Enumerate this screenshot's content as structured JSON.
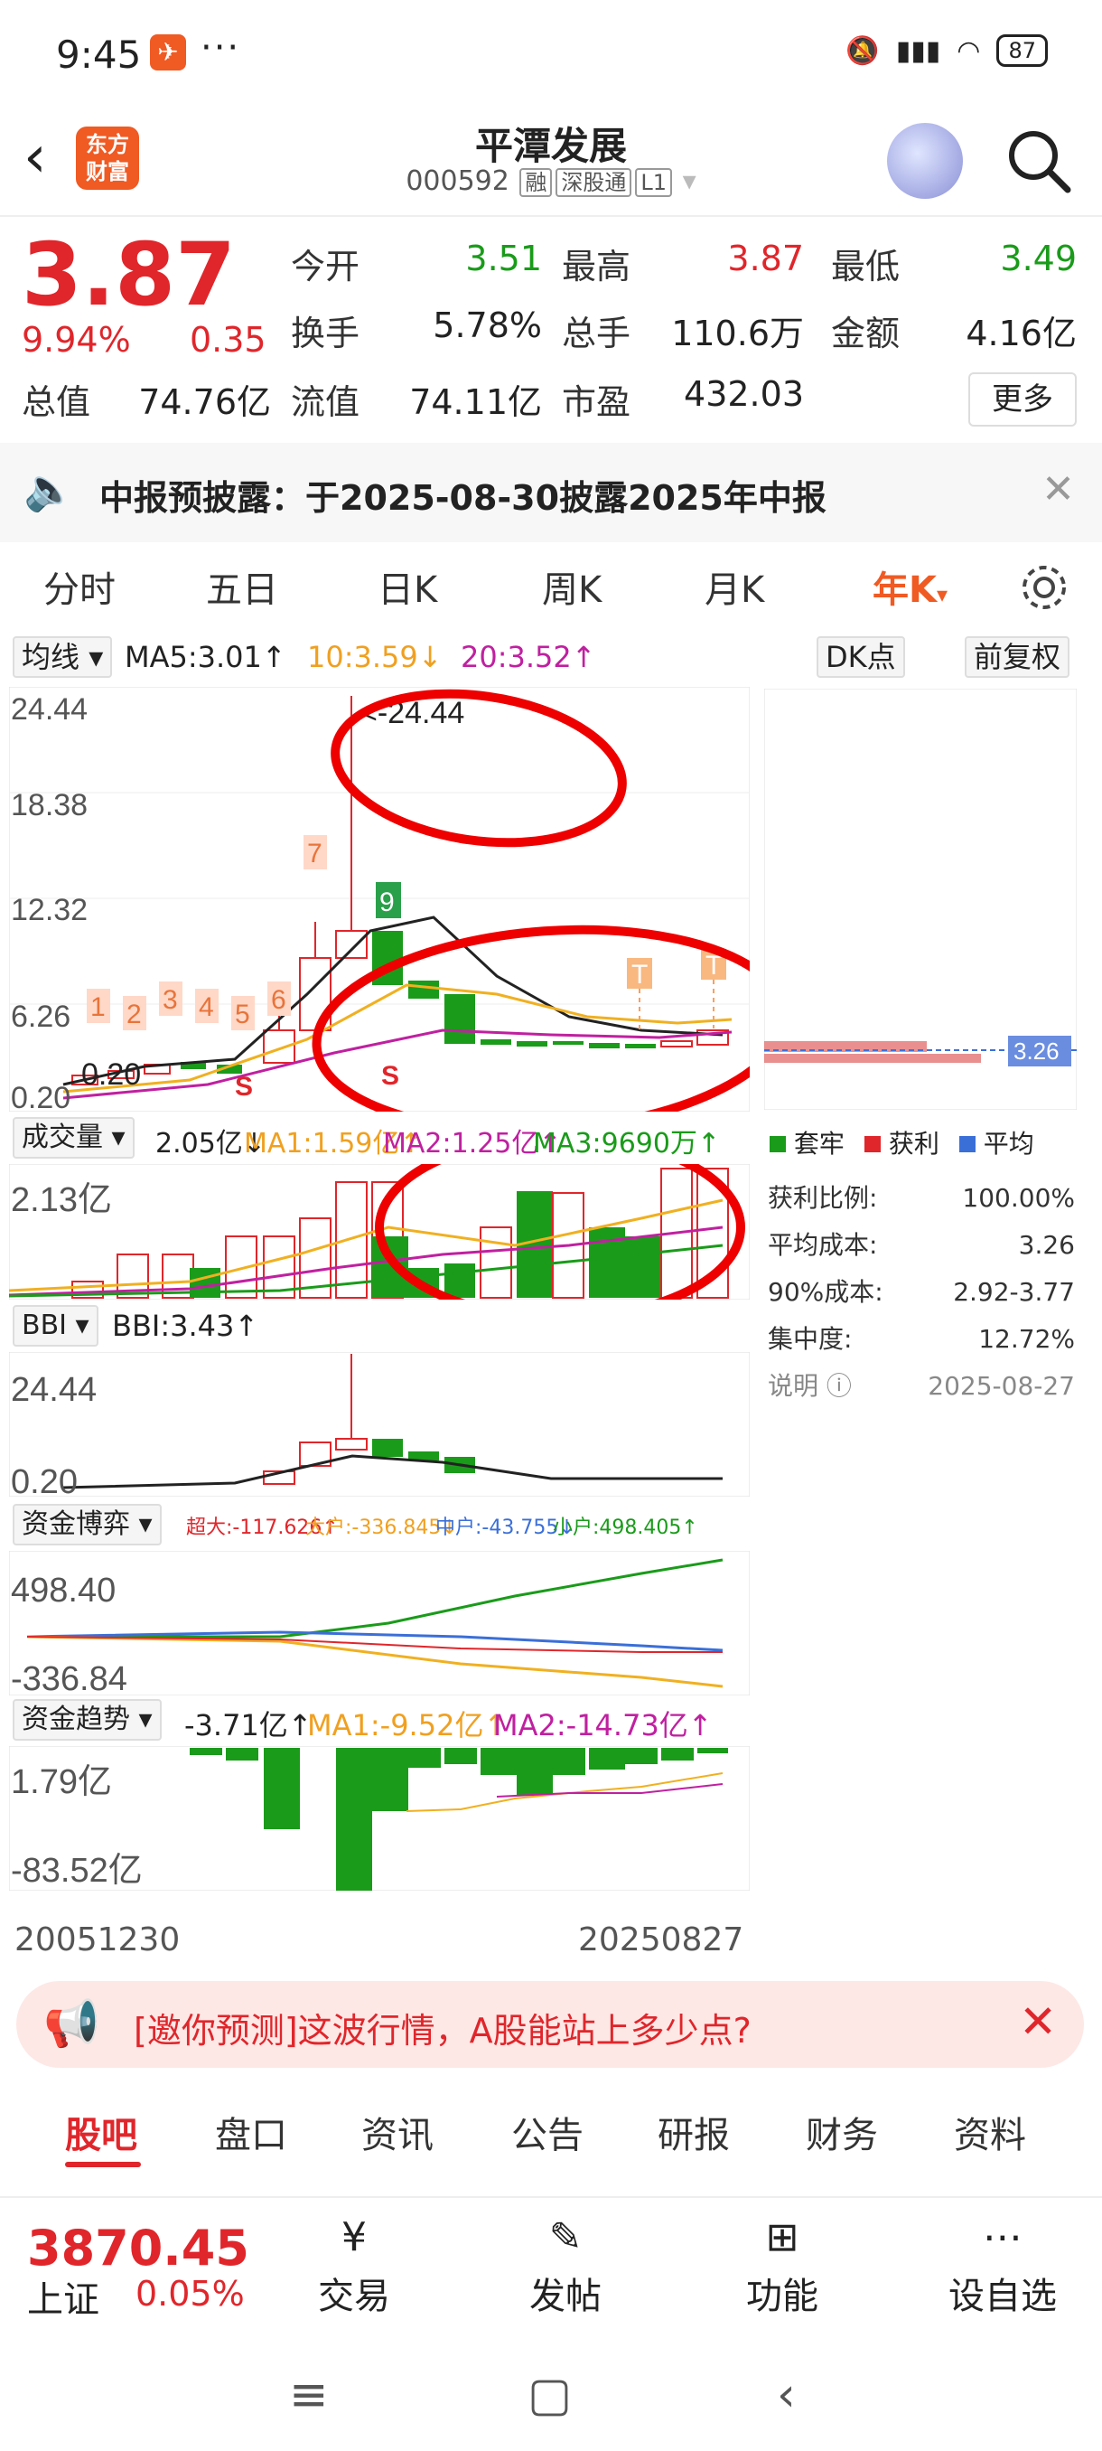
{
  "status": {
    "time": "9:45",
    "battery": "87"
  },
  "header": {
    "title": "平潭发展",
    "code": "000592",
    "tags": [
      "融",
      "深股通",
      "L1"
    ],
    "logo_line1": "东方",
    "logo_line2": "财富"
  },
  "quote": {
    "price": "3.87",
    "change_pct": "9.94%",
    "change": "0.35",
    "open_label": "今开",
    "open": "3.51",
    "high_label": "最高",
    "high": "3.87",
    "low_label": "最低",
    "low": "3.49",
    "turnover_label": "换手",
    "turnover": "5.78%",
    "volume_label": "总手",
    "volume": "110.6万",
    "amount_label": "金额",
    "amount": "4.16亿",
    "mktcap_label": "总值",
    "mktcap": "74.76亿",
    "float_label": "流值",
    "float": "74.11亿",
    "pe_label": "市盈",
    "pe": "432.03",
    "more": "更多"
  },
  "notice": {
    "text": "中报预披露：于2025-08-30披露2025年中报"
  },
  "tabs": [
    "分时",
    "五日",
    "日K",
    "周K",
    "月K",
    "年K"
  ],
  "main_chart": {
    "ma_dropdown": "均线",
    "ma5": "MA5:3.01↑",
    "ma10": "10:3.59↓",
    "ma20": "20:3.52↑",
    "dk": "DK点",
    "adjust": "前复权",
    "y_labels": [
      "24.44",
      "18.38",
      "12.32",
      "6.26",
      "0.20"
    ],
    "max_annot": "<-24.44",
    "min_annot": "0.20",
    "markers": [
      "1",
      "2",
      "3",
      "4",
      "5",
      "6",
      "7",
      "9"
    ],
    "avg_cost_label": "3.26"
  },
  "volume_chart": {
    "dropdown": "成交量",
    "v": "2.05亿↓",
    "ma1": "MA1:1.59亿↑",
    "ma2": "MA2:1.25亿↑",
    "ma3": "MA3:9690万↑",
    "y_label": "2.13亿"
  },
  "legend": {
    "a": "套牢",
    "b": "获利",
    "c": "平均"
  },
  "stats": {
    "profit_ratio_label": "获利比例:",
    "profit_ratio": "100.00%",
    "avg_cost_label": "平均成本:",
    "avg_cost": "3.26",
    "cost90_label": "90%成本:",
    "cost90": "2.92-3.77",
    "concentration_label": "集中度:",
    "concentration": "12.72%",
    "note_label": "说明",
    "date": "2025-08-27"
  },
  "bbi": {
    "dropdown": "BBI",
    "value": "BBI:3.43↑",
    "y_top": "24.44",
    "y_bottom": "0.20"
  },
  "fund_game": {
    "dropdown": "资金博弈",
    "super": "超大:-117.626↑",
    "large": "大户:-336.845↓",
    "mid": "中户:-43.755↓",
    "small": "小户:498.405↑",
    "y_top": "498.40",
    "y_bottom": "-336.84"
  },
  "fund_trend": {
    "dropdown": "资金趋势",
    "value": "-3.71亿↑",
    "ma1": "MA1:-9.52亿↑",
    "ma2": "MA2:-14.73亿↑",
    "y_top": "1.79亿",
    "y_bottom": "-83.52亿"
  },
  "dates": {
    "start": "20051230",
    "end": "20250827"
  },
  "ad": {
    "text": "[邀你预测]这波行情，A股能站上多少点?"
  },
  "bottom_tabs": [
    "股吧",
    "盘口",
    "资讯",
    "公告",
    "研报",
    "财务",
    "资料"
  ],
  "bottom_bar": {
    "index_value": "3870.45",
    "index_name": "上证",
    "index_pct": "0.05%",
    "items": [
      "交易",
      "发帖",
      "功能",
      "设自选"
    ]
  }
}
